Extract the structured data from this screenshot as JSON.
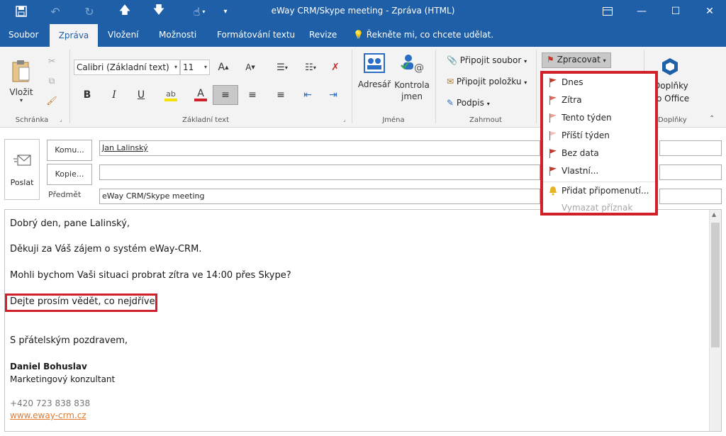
{
  "window": {
    "title": "eWay CRM/Skype meeting  -  Zpráva (HTML)"
  },
  "tabs": [
    "Soubor",
    "Zpráva",
    "Vložení",
    "Možnosti",
    "Formátování textu",
    "Revize"
  ],
  "tell_me": "Řekněte mi, co chcete udělat.",
  "ribbon": {
    "clipboard": {
      "paste": "Vložit",
      "group": "Schránka"
    },
    "font": {
      "family": "Calibri (Základní text)",
      "size": "11",
      "group": "Základní text"
    },
    "names": {
      "address_book": "Adresář",
      "check_names_1": "Kontrola",
      "check_names_2": "jmen",
      "group": "Jména"
    },
    "include": {
      "attach_file": "Připojit soubor",
      "attach_item": "Připojit položku",
      "signature": "Podpis",
      "group": "Zahrnout"
    },
    "tags": {
      "follow_up": "Zpracovat"
    },
    "addins": {
      "label_1": "Doplňky",
      "label_2": "o Office",
      "group": "Doplňky"
    }
  },
  "followup_menu": [
    {
      "label": "Dnes",
      "color": "#c0392b",
      "disabled": false
    },
    {
      "label": "Zítra",
      "color": "#d9695f",
      "disabled": false
    },
    {
      "label": "Tento týden",
      "color": "#e8a09a",
      "disabled": false
    },
    {
      "label": "Příští týden",
      "color": "#efc0bc",
      "disabled": false
    },
    {
      "label": "Bez data",
      "color": "#c0392b",
      "disabled": false
    },
    {
      "label": "Vlastní...",
      "color": "#c0392b",
      "disabled": false
    },
    {
      "label": "Přidat připomenutí...",
      "color": "#e6b422",
      "disabled": false
    },
    {
      "label": "Vymazat příznak",
      "color": "",
      "disabled": true
    }
  ],
  "compose": {
    "send": "Poslat",
    "to_button": "Komu...",
    "cc_button": "Kopie...",
    "subject_label": "Předmět",
    "to_value": "Jan Lalinský",
    "cc_value": "",
    "subject_value": "eWay CRM/Skype meeting"
  },
  "message": {
    "greeting": "Dobrý den, pane Lalinský,",
    "line1": "Děkuji za Váš zájem o systém eWay-CRM.",
    "line2": "Mohli bychom Vaši situaci probrat zítra ve 14:00 přes Skype?",
    "line3": "Dejte prosím vědět, co nejdříve.",
    "closing": "S přátelským pozdravem,",
    "sig_name": "Daniel Bohuslav",
    "sig_title": "Marketingový konzultant",
    "sig_phone": "+420 723 838 838",
    "sig_web": "www.eway-crm.cz"
  },
  "colors": {
    "accent": "#1f5fa8",
    "highlight": "#d0202a",
    "link": "#e07a2e"
  }
}
